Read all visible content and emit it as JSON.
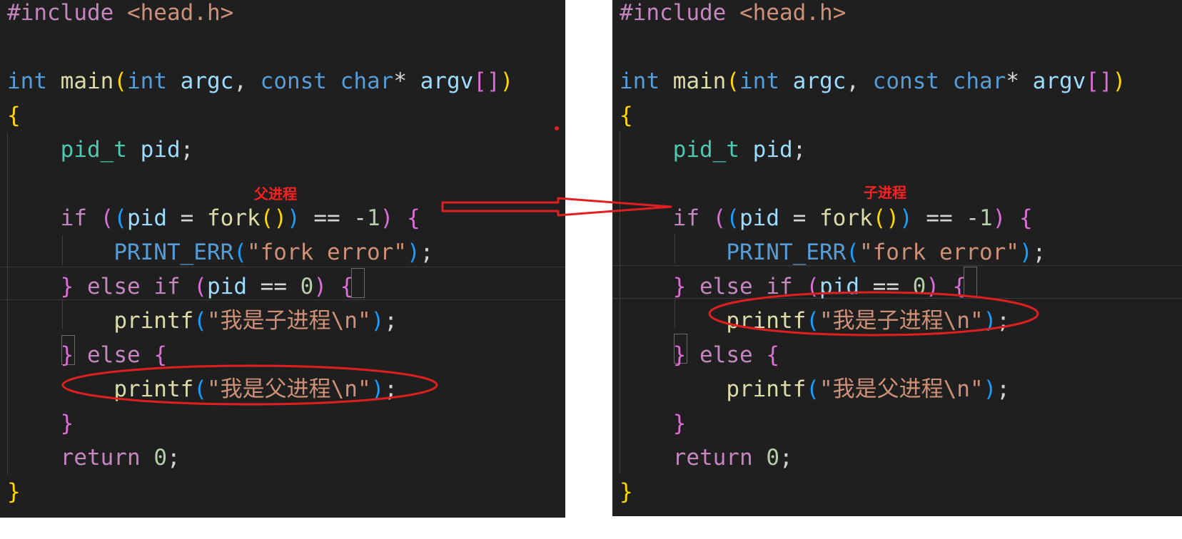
{
  "panels": {
    "left": {
      "annotation": "父进程",
      "lines": [
        [
          [
            "inc",
            "#include "
          ],
          [
            "hdr",
            "<head.h>"
          ]
        ],
        [],
        [
          [
            "kw",
            "int"
          ],
          [
            "pl",
            " "
          ],
          [
            "fn",
            "main"
          ],
          [
            "br1",
            "("
          ],
          [
            "kw",
            "int"
          ],
          [
            "pl",
            " "
          ],
          [
            "var",
            "argc"
          ],
          [
            "pl",
            ", "
          ],
          [
            "kw",
            "const"
          ],
          [
            "pl",
            " "
          ],
          [
            "kw",
            "char"
          ],
          [
            "pl",
            "* "
          ],
          [
            "var",
            "argv"
          ],
          [
            "br2",
            "[]"
          ],
          [
            "br1",
            ")"
          ]
        ],
        [
          [
            "br1",
            "{"
          ]
        ],
        [
          [
            "pl",
            "    "
          ],
          [
            "typ",
            "pid_t"
          ],
          [
            "pl",
            " "
          ],
          [
            "var",
            "pid"
          ],
          [
            "pl",
            ";"
          ]
        ],
        [],
        [
          [
            "pl",
            "    "
          ],
          [
            "ctl",
            "if"
          ],
          [
            "pl",
            " "
          ],
          [
            "br2",
            "("
          ],
          [
            "br3",
            "("
          ],
          [
            "var",
            "pid"
          ],
          [
            "pl",
            " = "
          ],
          [
            "fn",
            "fork"
          ],
          [
            "br1",
            "()"
          ],
          [
            "br3",
            ")"
          ],
          [
            "pl",
            " == -"
          ],
          [
            "num",
            "1"
          ],
          [
            "br2",
            ")"
          ],
          [
            "pl",
            " "
          ],
          [
            "br2",
            "{"
          ]
        ],
        [
          [
            "pl",
            "        "
          ],
          [
            "mac",
            "PRINT_ERR"
          ],
          [
            "br3",
            "("
          ],
          [
            "str",
            "\"fork error\""
          ],
          [
            "br3",
            ")"
          ],
          [
            "pl",
            ";"
          ]
        ],
        [
          [
            "pl",
            "    "
          ],
          [
            "br2",
            "}"
          ],
          [
            "pl",
            " "
          ],
          [
            "ctl",
            "else"
          ],
          [
            "pl",
            " "
          ],
          [
            "ctl",
            "if"
          ],
          [
            "pl",
            " "
          ],
          [
            "br2",
            "("
          ],
          [
            "var",
            "pid"
          ],
          [
            "pl",
            " == "
          ],
          [
            "num",
            "0"
          ],
          [
            "br2",
            ")"
          ],
          [
            "pl",
            " "
          ],
          [
            "br2",
            "{"
          ]
        ],
        [
          [
            "pl",
            "        "
          ],
          [
            "fn",
            "printf"
          ],
          [
            "br3",
            "("
          ],
          [
            "str",
            "\"我是子进程\\n\""
          ],
          [
            "br3",
            ")"
          ],
          [
            "pl",
            ";"
          ]
        ],
        [
          [
            "pl",
            "    "
          ],
          [
            "br2",
            "}"
          ],
          [
            "pl",
            " "
          ],
          [
            "ctl",
            "else"
          ],
          [
            "pl",
            " "
          ],
          [
            "br2",
            "{"
          ]
        ],
        [
          [
            "pl",
            "        "
          ],
          [
            "fn",
            "printf"
          ],
          [
            "br3",
            "("
          ],
          [
            "str",
            "\"我是父进程\\n\""
          ],
          [
            "br3",
            ")"
          ],
          [
            "pl",
            ";"
          ]
        ],
        [
          [
            "pl",
            "    "
          ],
          [
            "br2",
            "}"
          ]
        ],
        [
          [
            "pl",
            "    "
          ],
          [
            "ctl",
            "return"
          ],
          [
            "pl",
            " "
          ],
          [
            "num",
            "0"
          ],
          [
            "pl",
            ";"
          ]
        ],
        [
          [
            "br1",
            "}"
          ]
        ]
      ]
    },
    "right": {
      "annotation": "子进程",
      "lines": [
        [
          [
            "inc",
            "#include "
          ],
          [
            "hdr",
            "<head.h>"
          ]
        ],
        [],
        [
          [
            "kw",
            "int"
          ],
          [
            "pl",
            " "
          ],
          [
            "fn",
            "main"
          ],
          [
            "br1",
            "("
          ],
          [
            "kw",
            "int"
          ],
          [
            "pl",
            " "
          ],
          [
            "var",
            "argc"
          ],
          [
            "pl",
            ", "
          ],
          [
            "kw",
            "const"
          ],
          [
            "pl",
            " "
          ],
          [
            "kw",
            "char"
          ],
          [
            "pl",
            "* "
          ],
          [
            "var",
            "argv"
          ],
          [
            "br2",
            "[]"
          ],
          [
            "br1",
            ")"
          ]
        ],
        [
          [
            "br1",
            "{"
          ]
        ],
        [
          [
            "pl",
            "    "
          ],
          [
            "typ",
            "pid_t"
          ],
          [
            "pl",
            " "
          ],
          [
            "var",
            "pid"
          ],
          [
            "pl",
            ";"
          ]
        ],
        [],
        [
          [
            "pl",
            "    "
          ],
          [
            "ctl",
            "if"
          ],
          [
            "pl",
            " "
          ],
          [
            "br2",
            "("
          ],
          [
            "br3",
            "("
          ],
          [
            "var",
            "pid"
          ],
          [
            "pl",
            " = "
          ],
          [
            "fn",
            "fork"
          ],
          [
            "br1",
            "()"
          ],
          [
            "br3",
            ")"
          ],
          [
            "pl",
            " == -"
          ],
          [
            "num",
            "1"
          ],
          [
            "br2",
            ")"
          ],
          [
            "pl",
            " "
          ],
          [
            "br2",
            "{"
          ]
        ],
        [
          [
            "pl",
            "        "
          ],
          [
            "mac",
            "PRINT_ERR"
          ],
          [
            "br3",
            "("
          ],
          [
            "str",
            "\"fork error\""
          ],
          [
            "br3",
            ")"
          ],
          [
            "pl",
            ";"
          ]
        ],
        [
          [
            "pl",
            "    "
          ],
          [
            "br2",
            "}"
          ],
          [
            "pl",
            " "
          ],
          [
            "ctl",
            "else"
          ],
          [
            "pl",
            " "
          ],
          [
            "ctl",
            "if"
          ],
          [
            "pl",
            " "
          ],
          [
            "br2",
            "("
          ],
          [
            "var",
            "pid"
          ],
          [
            "pl",
            " == "
          ],
          [
            "num",
            "0"
          ],
          [
            "br2",
            ")"
          ],
          [
            "pl",
            " "
          ],
          [
            "br2",
            "{"
          ]
        ],
        [
          [
            "pl",
            "        "
          ],
          [
            "fn",
            "printf"
          ],
          [
            "br3",
            "("
          ],
          [
            "str",
            "\"我是子进程\\n\""
          ],
          [
            "br3",
            ")"
          ],
          [
            "pl",
            ";"
          ]
        ],
        [
          [
            "pl",
            "    "
          ],
          [
            "br2",
            "}"
          ],
          [
            "pl",
            " "
          ],
          [
            "ctl",
            "else"
          ],
          [
            "pl",
            " "
          ],
          [
            "br2",
            "{"
          ]
        ],
        [
          [
            "pl",
            "        "
          ],
          [
            "fn",
            "printf"
          ],
          [
            "br3",
            "("
          ],
          [
            "str",
            "\"我是父进程\\n\""
          ],
          [
            "br3",
            ")"
          ],
          [
            "pl",
            ";"
          ]
        ],
        [
          [
            "pl",
            "    "
          ],
          [
            "br2",
            "}"
          ]
        ],
        [
          [
            "pl",
            "    "
          ],
          [
            "ctl",
            "return"
          ],
          [
            "pl",
            " "
          ],
          [
            "num",
            "0"
          ],
          [
            "pl",
            ";"
          ]
        ],
        [
          [
            "br1",
            "}"
          ]
        ]
      ]
    }
  },
  "colors": {
    "editor_background": "#1f1f1f",
    "annotation_red": "#ff2020"
  }
}
